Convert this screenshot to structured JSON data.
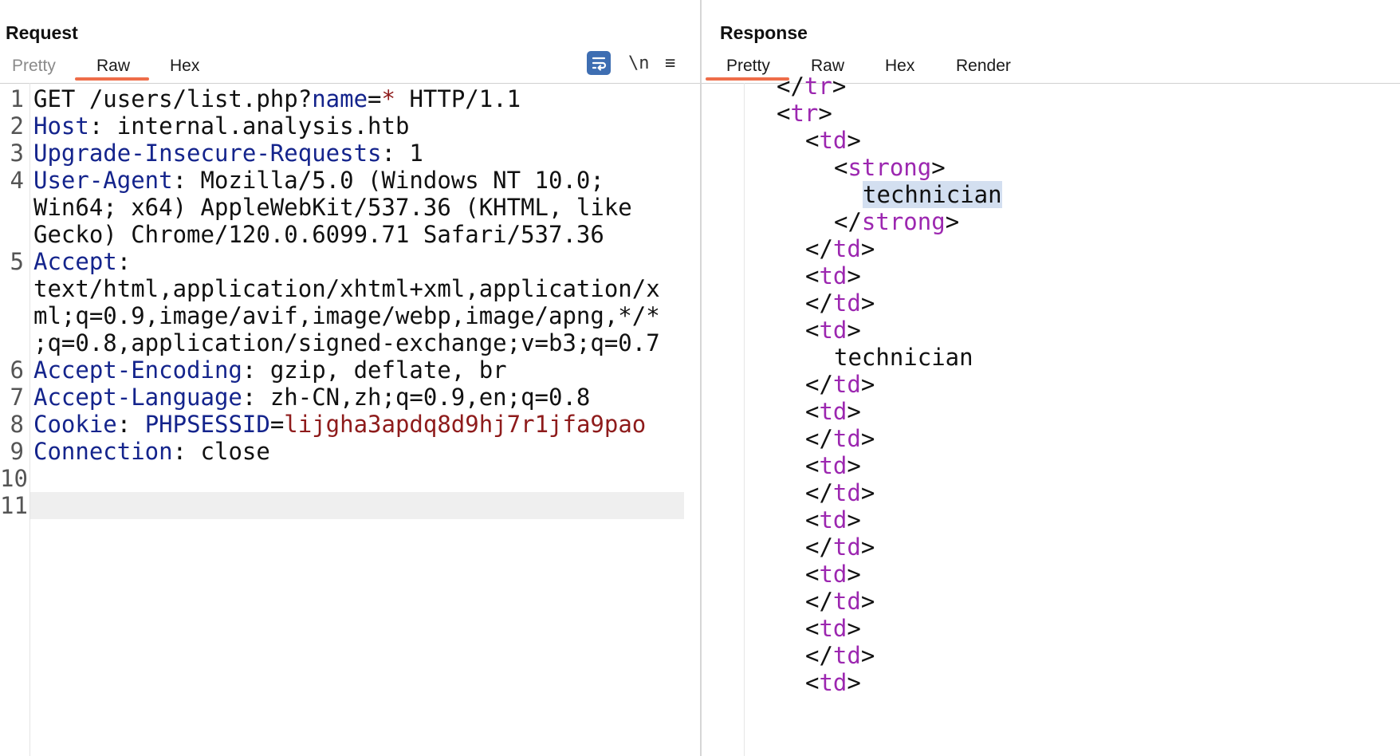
{
  "request": {
    "title": "Request",
    "tabs": [
      {
        "label": "Pretty",
        "active": false
      },
      {
        "label": "Raw",
        "active": true
      },
      {
        "label": "Hex",
        "active": false
      }
    ],
    "tools": {
      "newline": "\\n",
      "menu": "≡"
    },
    "lines": [
      {
        "no": "1",
        "parts": [
          [
            "GET /users/list.php?",
            ""
          ],
          [
            "name",
            "key"
          ],
          [
            "=",
            ""
          ],
          [
            "*",
            "ast"
          ],
          [
            " HTTP/1.1",
            ""
          ]
        ]
      },
      {
        "no": "2",
        "parts": [
          [
            "Host",
            "key"
          ],
          [
            ": internal.analysis.htb",
            ""
          ]
        ]
      },
      {
        "no": "3",
        "parts": [
          [
            "Upgrade-Insecure-Requests",
            "key"
          ],
          [
            ": 1",
            ""
          ]
        ]
      },
      {
        "no": "4",
        "parts": [
          [
            "User-Agent",
            "key"
          ],
          [
            ": Mozilla/5.0 (Windows NT 10.0;",
            ""
          ]
        ]
      },
      {
        "no": "",
        "parts": [
          [
            "Win64; x64) AppleWebKit/537.36 (KHTML, like",
            ""
          ]
        ]
      },
      {
        "no": "",
        "parts": [
          [
            "Gecko) Chrome/120.0.6099.71 Safari/537.36",
            ""
          ]
        ]
      },
      {
        "no": "5",
        "parts": [
          [
            "Accept",
            "key"
          ],
          [
            ":",
            ""
          ]
        ]
      },
      {
        "no": "",
        "parts": [
          [
            "text/html,application/xhtml+xml,application/x",
            ""
          ]
        ]
      },
      {
        "no": "",
        "parts": [
          [
            "ml;q=0.9,image/avif,image/webp,image/apng,*/*",
            ""
          ]
        ]
      },
      {
        "no": "",
        "parts": [
          [
            ";q=0.8,application/signed-exchange;v=b3;q=0.7",
            ""
          ]
        ]
      },
      {
        "no": "6",
        "parts": [
          [
            "Accept-Encoding",
            "key"
          ],
          [
            ": gzip, deflate, br",
            ""
          ]
        ]
      },
      {
        "no": "7",
        "parts": [
          [
            "Accept-Language",
            "key"
          ],
          [
            ": zh-CN,zh;q=0.9,en;q=0.8",
            ""
          ]
        ]
      },
      {
        "no": "8",
        "parts": [
          [
            "Cookie",
            "key"
          ],
          [
            ": ",
            ""
          ],
          [
            "PHPSESSID",
            "key"
          ],
          [
            "=",
            ""
          ],
          [
            "lijgha3apdq8d9hj7r1jfa9pao",
            "val"
          ]
        ]
      },
      {
        "no": "9",
        "parts": [
          [
            "Connection",
            "key"
          ],
          [
            ": close",
            ""
          ]
        ]
      },
      {
        "no": "10",
        "parts": []
      },
      {
        "no": "11",
        "parts": []
      }
    ]
  },
  "response": {
    "title": "Response",
    "tabs": [
      {
        "label": "Pretty",
        "active": true
      },
      {
        "label": "Raw",
        "active": false
      },
      {
        "label": "Hex",
        "active": false
      },
      {
        "label": "Render",
        "active": false
      }
    ],
    "lines": [
      {
        "indent": 0,
        "parts": [
          [
            "</",
            ""
          ],
          [
            "tr",
            "tag"
          ],
          [
            ">",
            ""
          ]
        ]
      },
      {
        "indent": 0,
        "parts": [
          [
            "<",
            ""
          ],
          [
            "tr",
            "tag"
          ],
          [
            ">",
            ""
          ]
        ]
      },
      {
        "indent": 1,
        "parts": [
          [
            "<",
            ""
          ],
          [
            "td",
            "tag"
          ],
          [
            ">",
            ""
          ]
        ]
      },
      {
        "indent": 2,
        "parts": [
          [
            "<",
            ""
          ],
          [
            "strong",
            "tag"
          ],
          [
            ">",
            ""
          ]
        ]
      },
      {
        "indent": 3,
        "parts": [
          [
            "technician",
            "hl"
          ]
        ]
      },
      {
        "indent": 2,
        "parts": [
          [
            "</",
            ""
          ],
          [
            "strong",
            "tag"
          ],
          [
            ">",
            ""
          ]
        ]
      },
      {
        "indent": 1,
        "parts": [
          [
            "</",
            ""
          ],
          [
            "td",
            "tag"
          ],
          [
            ">",
            ""
          ]
        ]
      },
      {
        "indent": 1,
        "parts": [
          [
            "<",
            ""
          ],
          [
            "td",
            "tag"
          ],
          [
            ">",
            ""
          ]
        ]
      },
      {
        "indent": 1,
        "parts": [
          [
            "</",
            ""
          ],
          [
            "td",
            "tag"
          ],
          [
            ">",
            ""
          ]
        ]
      },
      {
        "indent": 1,
        "parts": [
          [
            "<",
            ""
          ],
          [
            "td",
            "tag"
          ],
          [
            ">",
            ""
          ]
        ]
      },
      {
        "indent": 2,
        "parts": [
          [
            "technician",
            ""
          ]
        ]
      },
      {
        "indent": 1,
        "parts": [
          [
            "</",
            ""
          ],
          [
            "td",
            "tag"
          ],
          [
            ">",
            ""
          ]
        ]
      },
      {
        "indent": 1,
        "parts": [
          [
            "<",
            ""
          ],
          [
            "td",
            "tag"
          ],
          [
            ">",
            ""
          ]
        ]
      },
      {
        "indent": 1,
        "parts": [
          [
            "</",
            ""
          ],
          [
            "td",
            "tag"
          ],
          [
            ">",
            ""
          ]
        ]
      },
      {
        "indent": 1,
        "parts": [
          [
            "<",
            ""
          ],
          [
            "td",
            "tag"
          ],
          [
            ">",
            ""
          ]
        ]
      },
      {
        "indent": 1,
        "parts": [
          [
            "</",
            ""
          ],
          [
            "td",
            "tag"
          ],
          [
            ">",
            ""
          ]
        ]
      },
      {
        "indent": 1,
        "parts": [
          [
            "<",
            ""
          ],
          [
            "td",
            "tag"
          ],
          [
            ">",
            ""
          ]
        ]
      },
      {
        "indent": 1,
        "parts": [
          [
            "</",
            ""
          ],
          [
            "td",
            "tag"
          ],
          [
            ">",
            ""
          ]
        ]
      },
      {
        "indent": 1,
        "parts": [
          [
            "<",
            ""
          ],
          [
            "td",
            "tag"
          ],
          [
            ">",
            ""
          ]
        ]
      },
      {
        "indent": 1,
        "parts": [
          [
            "</",
            ""
          ],
          [
            "td",
            "tag"
          ],
          [
            ">",
            ""
          ]
        ]
      },
      {
        "indent": 1,
        "parts": [
          [
            "<",
            ""
          ],
          [
            "td",
            "tag"
          ],
          [
            ">",
            ""
          ]
        ]
      },
      {
        "indent": 1,
        "parts": [
          [
            "</",
            ""
          ],
          [
            "td",
            "tag"
          ],
          [
            ">",
            ""
          ]
        ]
      },
      {
        "indent": 1,
        "parts": [
          [
            "<",
            ""
          ],
          [
            "td",
            "tag"
          ],
          [
            ">",
            ""
          ]
        ]
      }
    ]
  },
  "colors": {
    "accent": "#ee6d49",
    "key": "#14248c",
    "value": "#8e1b1b",
    "tag": "#9c27b0",
    "wrap_button": "#3e6eb2"
  }
}
